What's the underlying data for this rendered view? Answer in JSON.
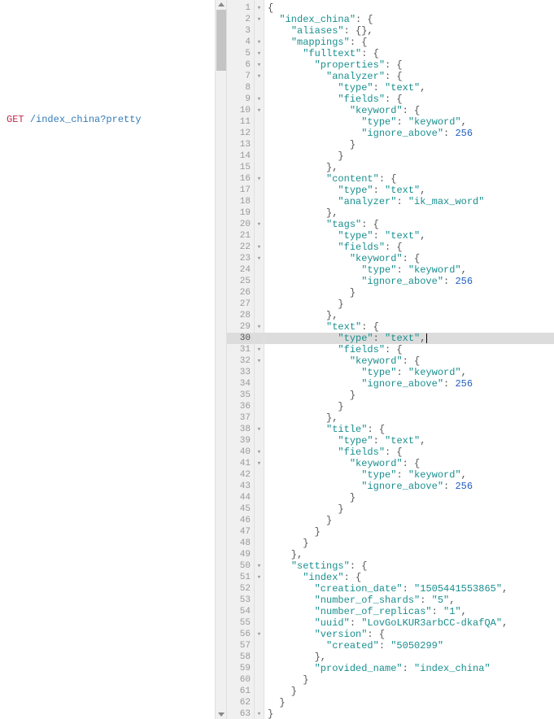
{
  "left": {
    "method": "GET",
    "url": "/index_china?pretty"
  },
  "code": {
    "highlighted_line": 30,
    "lines": [
      {
        "n": 1,
        "fold": "-",
        "t": [
          [
            "p",
            "{"
          ]
        ]
      },
      {
        "n": 2,
        "fold": "-",
        "t": [
          [
            "p",
            "  "
          ],
          [
            "k",
            "\"index_china\""
          ],
          [
            "p",
            ": {"
          ]
        ]
      },
      {
        "n": 3,
        "fold": "",
        "t": [
          [
            "p",
            "    "
          ],
          [
            "k",
            "\"aliases\""
          ],
          [
            "p",
            ": {},"
          ]
        ]
      },
      {
        "n": 4,
        "fold": "-",
        "t": [
          [
            "p",
            "    "
          ],
          [
            "k",
            "\"mappings\""
          ],
          [
            "p",
            ": {"
          ]
        ]
      },
      {
        "n": 5,
        "fold": "-",
        "t": [
          [
            "p",
            "      "
          ],
          [
            "k",
            "\"fulltext\""
          ],
          [
            "p",
            ": {"
          ]
        ]
      },
      {
        "n": 6,
        "fold": "-",
        "t": [
          [
            "p",
            "        "
          ],
          [
            "k",
            "\"properties\""
          ],
          [
            "p",
            ": {"
          ]
        ]
      },
      {
        "n": 7,
        "fold": "-",
        "t": [
          [
            "p",
            "          "
          ],
          [
            "k",
            "\"analyzer\""
          ],
          [
            "p",
            ": {"
          ]
        ]
      },
      {
        "n": 8,
        "fold": "",
        "t": [
          [
            "p",
            "            "
          ],
          [
            "k",
            "\"type\""
          ],
          [
            "p",
            ": "
          ],
          [
            "s",
            "\"text\""
          ],
          [
            "p",
            ","
          ]
        ]
      },
      {
        "n": 9,
        "fold": "-",
        "t": [
          [
            "p",
            "            "
          ],
          [
            "k",
            "\"fields\""
          ],
          [
            "p",
            ": {"
          ]
        ]
      },
      {
        "n": 10,
        "fold": "-",
        "t": [
          [
            "p",
            "              "
          ],
          [
            "k",
            "\"keyword\""
          ],
          [
            "p",
            ": {"
          ]
        ]
      },
      {
        "n": 11,
        "fold": "",
        "t": [
          [
            "p",
            "                "
          ],
          [
            "k",
            "\"type\""
          ],
          [
            "p",
            ": "
          ],
          [
            "s",
            "\"keyword\""
          ],
          [
            "p",
            ","
          ]
        ]
      },
      {
        "n": 12,
        "fold": "",
        "t": [
          [
            "p",
            "                "
          ],
          [
            "k",
            "\"ignore_above\""
          ],
          [
            "p",
            ": "
          ],
          [
            "n",
            "256"
          ]
        ]
      },
      {
        "n": 13,
        "fold": "",
        "t": [
          [
            "p",
            "              }"
          ]
        ]
      },
      {
        "n": 14,
        "fold": "",
        "t": [
          [
            "p",
            "            }"
          ]
        ]
      },
      {
        "n": 15,
        "fold": "",
        "t": [
          [
            "p",
            "          },"
          ]
        ]
      },
      {
        "n": 16,
        "fold": "-",
        "t": [
          [
            "p",
            "          "
          ],
          [
            "k",
            "\"content\""
          ],
          [
            "p",
            ": {"
          ]
        ]
      },
      {
        "n": 17,
        "fold": "",
        "t": [
          [
            "p",
            "            "
          ],
          [
            "k",
            "\"type\""
          ],
          [
            "p",
            ": "
          ],
          [
            "s",
            "\"text\""
          ],
          [
            "p",
            ","
          ]
        ]
      },
      {
        "n": 18,
        "fold": "",
        "t": [
          [
            "p",
            "            "
          ],
          [
            "k",
            "\"analyzer\""
          ],
          [
            "p",
            ": "
          ],
          [
            "s",
            "\"ik_max_word\""
          ]
        ]
      },
      {
        "n": 19,
        "fold": "",
        "t": [
          [
            "p",
            "          },"
          ]
        ]
      },
      {
        "n": 20,
        "fold": "-",
        "t": [
          [
            "p",
            "          "
          ],
          [
            "k",
            "\"tags\""
          ],
          [
            "p",
            ": {"
          ]
        ]
      },
      {
        "n": 21,
        "fold": "",
        "t": [
          [
            "p",
            "            "
          ],
          [
            "k",
            "\"type\""
          ],
          [
            "p",
            ": "
          ],
          [
            "s",
            "\"text\""
          ],
          [
            "p",
            ","
          ]
        ]
      },
      {
        "n": 22,
        "fold": "-",
        "t": [
          [
            "p",
            "            "
          ],
          [
            "k",
            "\"fields\""
          ],
          [
            "p",
            ": {"
          ]
        ]
      },
      {
        "n": 23,
        "fold": "-",
        "t": [
          [
            "p",
            "              "
          ],
          [
            "k",
            "\"keyword\""
          ],
          [
            "p",
            ": {"
          ]
        ]
      },
      {
        "n": 24,
        "fold": "",
        "t": [
          [
            "p",
            "                "
          ],
          [
            "k",
            "\"type\""
          ],
          [
            "p",
            ": "
          ],
          [
            "s",
            "\"keyword\""
          ],
          [
            "p",
            ","
          ]
        ]
      },
      {
        "n": 25,
        "fold": "",
        "t": [
          [
            "p",
            "                "
          ],
          [
            "k",
            "\"ignore_above\""
          ],
          [
            "p",
            ": "
          ],
          [
            "n",
            "256"
          ]
        ]
      },
      {
        "n": 26,
        "fold": "",
        "t": [
          [
            "p",
            "              }"
          ]
        ]
      },
      {
        "n": 27,
        "fold": "",
        "t": [
          [
            "p",
            "            }"
          ]
        ]
      },
      {
        "n": 28,
        "fold": "",
        "t": [
          [
            "p",
            "          },"
          ]
        ]
      },
      {
        "n": 29,
        "fold": "-",
        "t": [
          [
            "p",
            "          "
          ],
          [
            "k",
            "\"text\""
          ],
          [
            "p",
            ": {"
          ]
        ]
      },
      {
        "n": 30,
        "fold": "",
        "t": [
          [
            "p",
            "            "
          ],
          [
            "k",
            "\"type\""
          ],
          [
            "p",
            ": "
          ],
          [
            "s",
            "\"text\""
          ],
          [
            "p",
            ","
          ]
        ],
        "cursor": true
      },
      {
        "n": 31,
        "fold": "-",
        "t": [
          [
            "p",
            "            "
          ],
          [
            "k",
            "\"fields\""
          ],
          [
            "p",
            ": {"
          ]
        ]
      },
      {
        "n": 32,
        "fold": "-",
        "t": [
          [
            "p",
            "              "
          ],
          [
            "k",
            "\"keyword\""
          ],
          [
            "p",
            ": {"
          ]
        ]
      },
      {
        "n": 33,
        "fold": "",
        "t": [
          [
            "p",
            "                "
          ],
          [
            "k",
            "\"type\""
          ],
          [
            "p",
            ": "
          ],
          [
            "s",
            "\"keyword\""
          ],
          [
            "p",
            ","
          ]
        ]
      },
      {
        "n": 34,
        "fold": "",
        "t": [
          [
            "p",
            "                "
          ],
          [
            "k",
            "\"ignore_above\""
          ],
          [
            "p",
            ": "
          ],
          [
            "n",
            "256"
          ]
        ]
      },
      {
        "n": 35,
        "fold": "",
        "t": [
          [
            "p",
            "              }"
          ]
        ]
      },
      {
        "n": 36,
        "fold": "",
        "t": [
          [
            "p",
            "            }"
          ]
        ]
      },
      {
        "n": 37,
        "fold": "",
        "t": [
          [
            "p",
            "          },"
          ]
        ]
      },
      {
        "n": 38,
        "fold": "-",
        "t": [
          [
            "p",
            "          "
          ],
          [
            "k",
            "\"title\""
          ],
          [
            "p",
            ": {"
          ]
        ]
      },
      {
        "n": 39,
        "fold": "",
        "t": [
          [
            "p",
            "            "
          ],
          [
            "k",
            "\"type\""
          ],
          [
            "p",
            ": "
          ],
          [
            "s",
            "\"text\""
          ],
          [
            "p",
            ","
          ]
        ]
      },
      {
        "n": 40,
        "fold": "-",
        "t": [
          [
            "p",
            "            "
          ],
          [
            "k",
            "\"fields\""
          ],
          [
            "p",
            ": {"
          ]
        ]
      },
      {
        "n": 41,
        "fold": "-",
        "t": [
          [
            "p",
            "              "
          ],
          [
            "k",
            "\"keyword\""
          ],
          [
            "p",
            ": {"
          ]
        ]
      },
      {
        "n": 42,
        "fold": "",
        "t": [
          [
            "p",
            "                "
          ],
          [
            "k",
            "\"type\""
          ],
          [
            "p",
            ": "
          ],
          [
            "s",
            "\"keyword\""
          ],
          [
            "p",
            ","
          ]
        ]
      },
      {
        "n": 43,
        "fold": "",
        "t": [
          [
            "p",
            "                "
          ],
          [
            "k",
            "\"ignore_above\""
          ],
          [
            "p",
            ": "
          ],
          [
            "n",
            "256"
          ]
        ]
      },
      {
        "n": 44,
        "fold": "",
        "t": [
          [
            "p",
            "              }"
          ]
        ]
      },
      {
        "n": 45,
        "fold": "",
        "t": [
          [
            "p",
            "            }"
          ]
        ]
      },
      {
        "n": 46,
        "fold": "",
        "t": [
          [
            "p",
            "          }"
          ]
        ]
      },
      {
        "n": 47,
        "fold": "",
        "t": [
          [
            "p",
            "        }"
          ]
        ]
      },
      {
        "n": 48,
        "fold": "",
        "t": [
          [
            "p",
            "      }"
          ]
        ]
      },
      {
        "n": 49,
        "fold": "",
        "t": [
          [
            "p",
            "    },"
          ]
        ]
      },
      {
        "n": 50,
        "fold": "-",
        "t": [
          [
            "p",
            "    "
          ],
          [
            "k",
            "\"settings\""
          ],
          [
            "p",
            ": {"
          ]
        ]
      },
      {
        "n": 51,
        "fold": "-",
        "t": [
          [
            "p",
            "      "
          ],
          [
            "k",
            "\"index\""
          ],
          [
            "p",
            ": {"
          ]
        ]
      },
      {
        "n": 52,
        "fold": "",
        "t": [
          [
            "p",
            "        "
          ],
          [
            "k",
            "\"creation_date\""
          ],
          [
            "p",
            ": "
          ],
          [
            "s",
            "\"1505441553865\""
          ],
          [
            "p",
            ","
          ]
        ]
      },
      {
        "n": 53,
        "fold": "",
        "t": [
          [
            "p",
            "        "
          ],
          [
            "k",
            "\"number_of_shards\""
          ],
          [
            "p",
            ": "
          ],
          [
            "s",
            "\"5\""
          ],
          [
            "p",
            ","
          ]
        ]
      },
      {
        "n": 54,
        "fold": "",
        "t": [
          [
            "p",
            "        "
          ],
          [
            "k",
            "\"number_of_replicas\""
          ],
          [
            "p",
            ": "
          ],
          [
            "s",
            "\"1\""
          ],
          [
            "p",
            ","
          ]
        ]
      },
      {
        "n": 55,
        "fold": "",
        "t": [
          [
            "p",
            "        "
          ],
          [
            "k",
            "\"uuid\""
          ],
          [
            "p",
            ": "
          ],
          [
            "s",
            "\"LovGoLKUR3arbCC-dkafQA\""
          ],
          [
            "p",
            ","
          ]
        ]
      },
      {
        "n": 56,
        "fold": "-",
        "t": [
          [
            "p",
            "        "
          ],
          [
            "k",
            "\"version\""
          ],
          [
            "p",
            ": {"
          ]
        ]
      },
      {
        "n": 57,
        "fold": "",
        "t": [
          [
            "p",
            "          "
          ],
          [
            "k",
            "\"created\""
          ],
          [
            "p",
            ": "
          ],
          [
            "s",
            "\"5050299\""
          ]
        ]
      },
      {
        "n": 58,
        "fold": "",
        "t": [
          [
            "p",
            "        },"
          ]
        ]
      },
      {
        "n": 59,
        "fold": "",
        "t": [
          [
            "p",
            "        "
          ],
          [
            "k",
            "\"provided_name\""
          ],
          [
            "p",
            ": "
          ],
          [
            "s",
            "\"index_china\""
          ]
        ]
      },
      {
        "n": 60,
        "fold": "",
        "t": [
          [
            "p",
            "      }"
          ]
        ]
      },
      {
        "n": 61,
        "fold": "",
        "t": [
          [
            "p",
            "    }"
          ]
        ]
      },
      {
        "n": 62,
        "fold": "",
        "t": [
          [
            "p",
            "  }"
          ]
        ]
      },
      {
        "n": 63,
        "fold": "-",
        "t": [
          [
            "p",
            "}"
          ]
        ]
      }
    ]
  }
}
